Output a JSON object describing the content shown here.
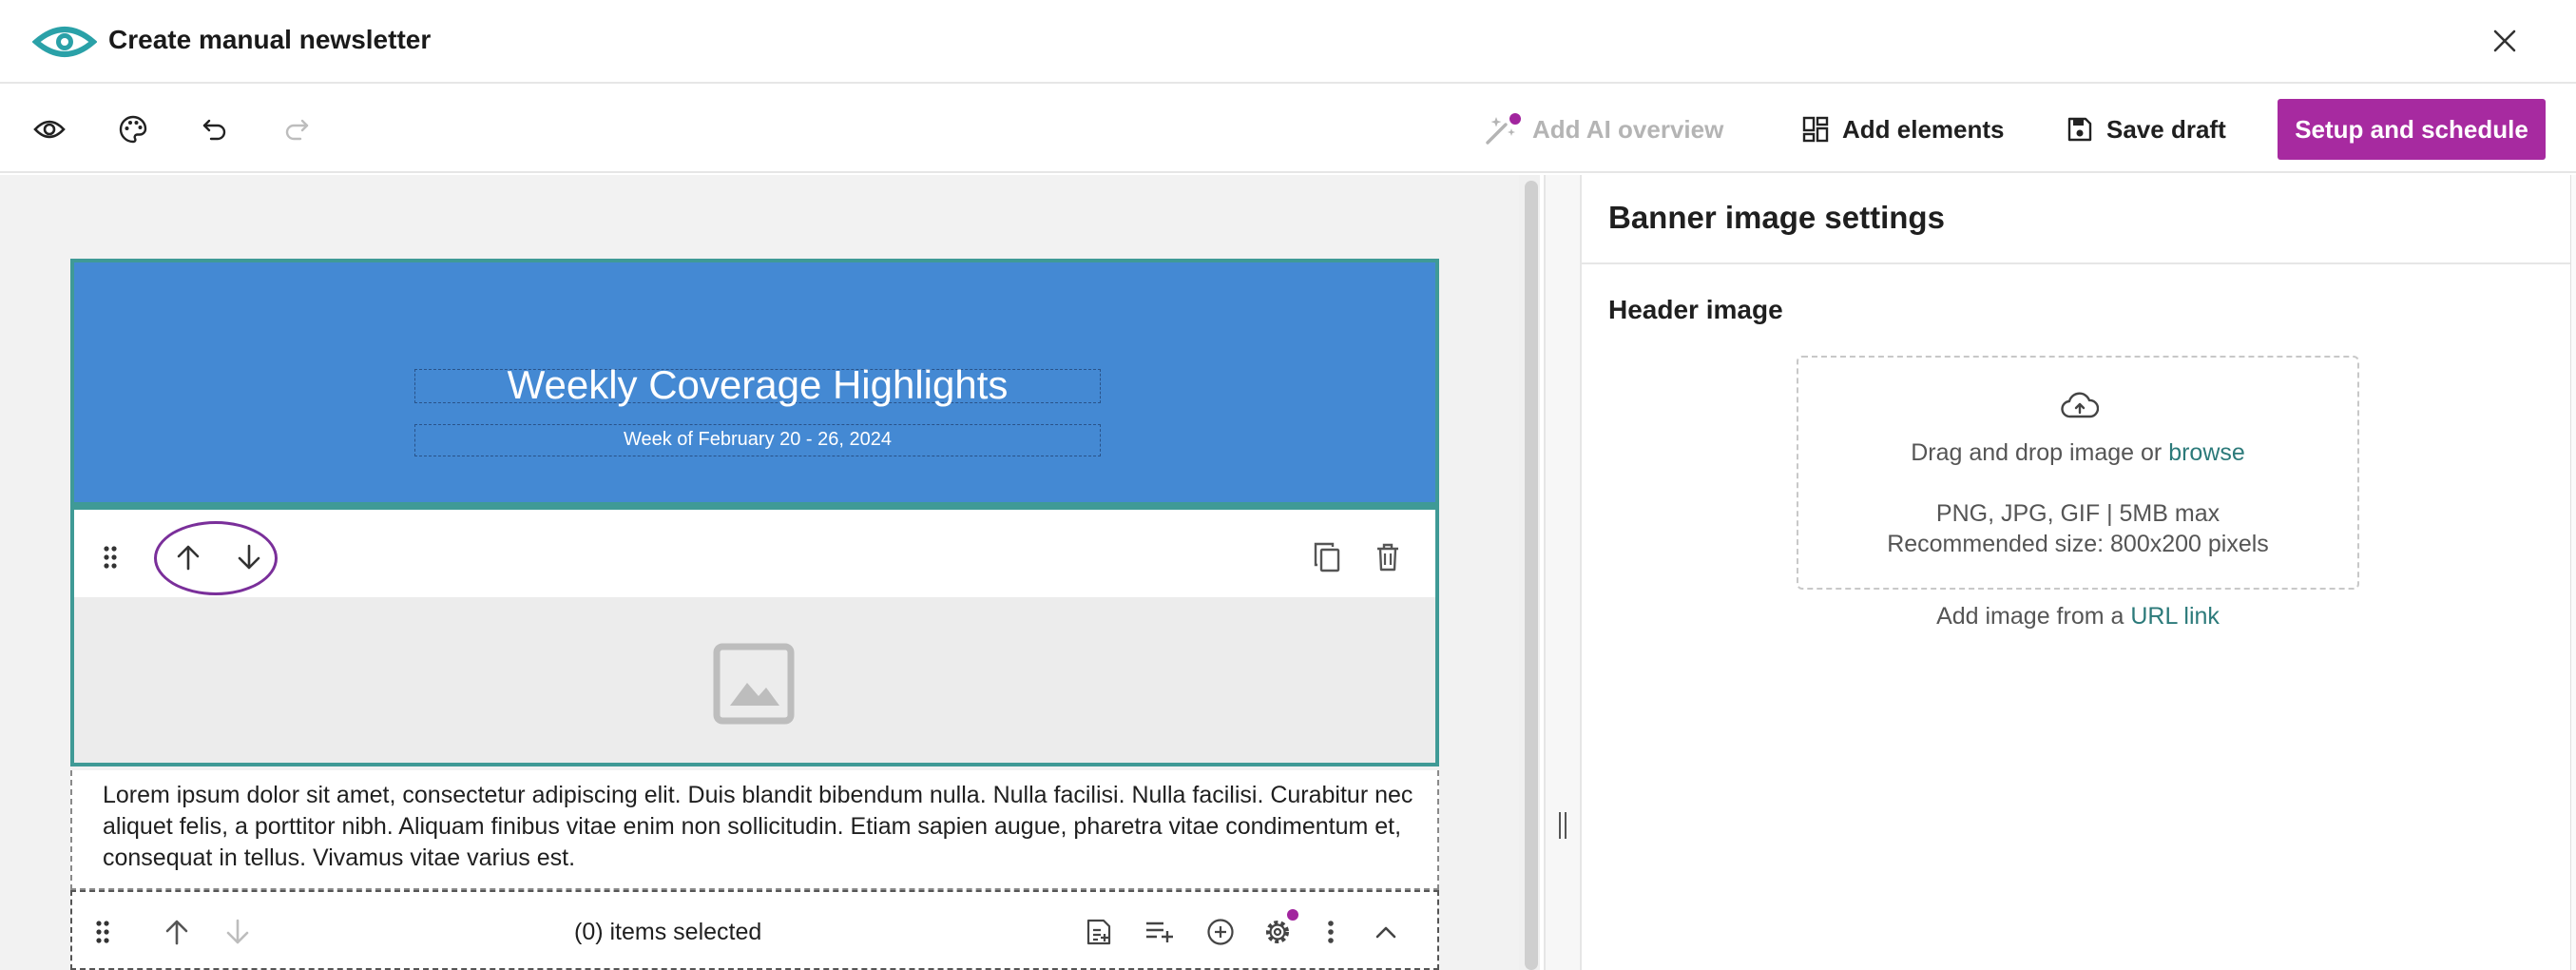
{
  "app": {
    "title": "Create manual newsletter"
  },
  "toolbar": {
    "icons": [
      "eye-icon",
      "palette-icon",
      "undo-icon",
      "redo-icon"
    ],
    "ai_overview_label": "Add AI overview",
    "add_elements_label": "Add elements",
    "save_draft_label": "Save draft",
    "setup_schedule_label": "Setup and schedule"
  },
  "banner": {
    "title": "Weekly Coverage Highlights",
    "subtitle": "Week of February 20 - 26, 2024"
  },
  "text_block": {
    "body": "Lorem ipsum dolor sit amet, consectetur adipiscing elit. Duis blandit bibendum nulla. Nulla facilisi. Nulla facilisi. Curabitur nec aliquet felis, a porttitor nibh. Aliquam finibus vitae enim non sollicitudin. Etiam sapien augue, pharetra vitae condimentum et, consequat in tellus. Vivamus vitae varius est."
  },
  "bottom_bar": {
    "items_selected": "(0) items selected"
  },
  "panel": {
    "title": "Banner image settings",
    "section_title": "Header image",
    "dropzone_text": "Drag and drop image or",
    "browse_link": "browse",
    "formats": "PNG, JPG, GIF | 5MB max",
    "recommended": "Recommended size: 800x200 pixels",
    "url_text": "Add image from a",
    "url_link": "URL link"
  },
  "colors": {
    "brand_primary": "#a72aa0",
    "banner_bg": "#4489d3",
    "selection_border": "#3f9a96",
    "link": "#2c7a7a",
    "highlight_ring": "#7a2f9a"
  }
}
